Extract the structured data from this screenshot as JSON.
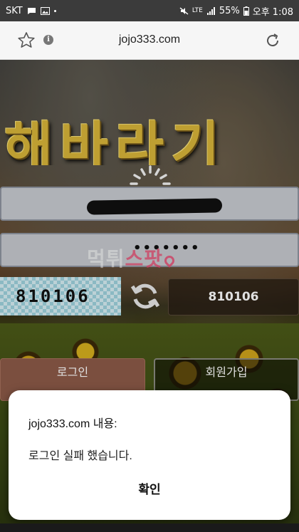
{
  "status_bar": {
    "carrier": "SKT",
    "network": "LTE",
    "battery": "55%",
    "time": "오후 1:08"
  },
  "browser": {
    "url": "jojo333.com"
  },
  "site": {
    "logo_text": "해바라기",
    "password_masked": "•••••••",
    "watermark_a": "먹튀",
    "watermark_b": "스팟",
    "captcha_code": "810106",
    "captcha_input_value": "810106",
    "login_label": "로그인",
    "join_label": "회원가입"
  },
  "dialog": {
    "title": "jojo333.com 내용:",
    "message": "로그인 실패 했습니다.",
    "ok_label": "확인"
  },
  "colors": {
    "status_bar_bg": "#3b3b3b",
    "url_bar_bg": "#f6f6f6",
    "logo_gold": "#d9b53a",
    "login_button": "#8c5a48",
    "dialog_bg": "#ffffff"
  }
}
